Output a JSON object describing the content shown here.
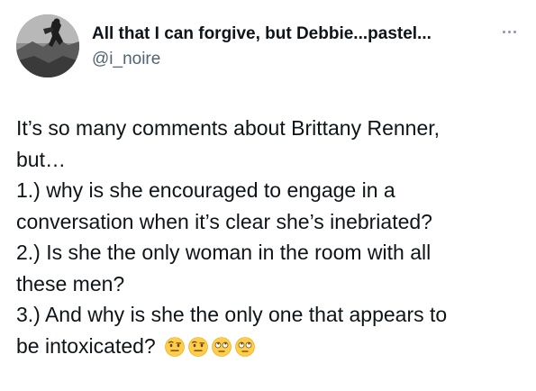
{
  "author": {
    "display_name": "All that I can forgive, but Debbie...pastel...",
    "handle": "@i_noire",
    "avatar_icon": "profile-photo"
  },
  "menu": {
    "icon": "more-horizontal-icon"
  },
  "tweet": {
    "lines": [
      "It’s so many comments about Brittany Renner,",
      "but…",
      "1.) why is she encouraged to engage in a",
      "conversation when it’s clear she’s inebriated?",
      "2.) Is she the only woman in the room with all",
      "these men?",
      "3.) And why is she the only one that appears to",
      "be intoxicated?"
    ],
    "emojis": [
      "face-with-raised-eyebrow-emoji",
      "face-with-raised-eyebrow-emoji",
      "face-with-rolling-eyes-emoji",
      "face-with-rolling-eyes-emoji"
    ]
  },
  "colors": {
    "text": "#0f1419",
    "secondary": "#536471",
    "emoji_yellow": "#ffcc4d"
  }
}
